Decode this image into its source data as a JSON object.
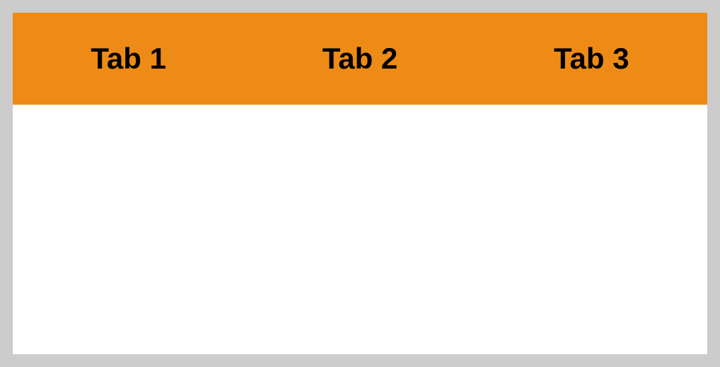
{
  "tabs": [
    {
      "label": "Tab 1"
    },
    {
      "label": "Tab 2"
    },
    {
      "label": "Tab 3"
    }
  ],
  "colors": {
    "tabbar_bg": "#ed8b16",
    "page_bg": "#cccccc",
    "panel_bg": "#ffffff"
  }
}
